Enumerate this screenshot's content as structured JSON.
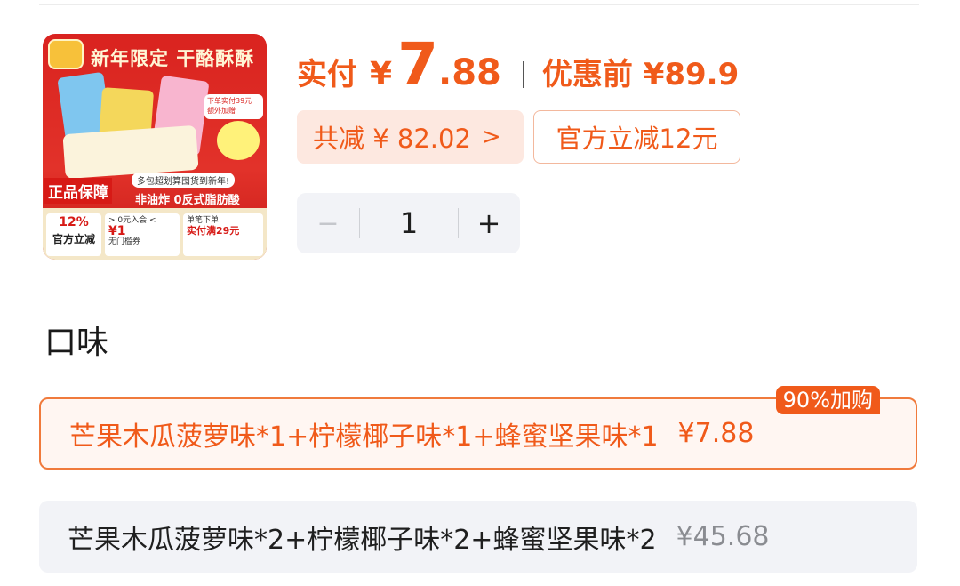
{
  "product": {
    "image": {
      "headline": "新年限定 干酪酥酥",
      "guarantee_badge": "正品保障",
      "slogan": "多包超划算囤货到新年!",
      "feature": "非油炸 0反式脂肪酸",
      "side_note": "下单实付39元 额外加赠",
      "pct_value": "12%",
      "pct_label": "官方立减",
      "coupon_top": "> 0元入会 <",
      "coupon_value": "¥1",
      "coupon_label": "无门槛券",
      "promo_top": "单笔下单",
      "promo_value": "实付满29元"
    }
  },
  "price": {
    "pay_label": "实付",
    "currency": "¥",
    "integer": "7",
    "decimal": ".88",
    "original": "优惠前 ¥89.9",
    "reduce_label": "共减 ¥ 82.02",
    "reduce_chevron": ">",
    "official_discount": "官方立减12元"
  },
  "quantity": {
    "minus": "−",
    "value": "1",
    "plus": "+"
  },
  "flavor": {
    "title": "口味",
    "options": [
      {
        "name": "芒果木瓜菠萝味*1+柠檬椰子味*1+蜂蜜坚果味*1",
        "price": "¥7.88",
        "tag": "90%加购",
        "selected": true
      },
      {
        "name": "芒果木瓜菠萝味*2+柠檬椰子味*2+蜂蜜坚果味*2",
        "price": "¥45.68",
        "selected": false
      }
    ]
  },
  "colors": {
    "accent": "#f05a1a",
    "chip_bg": "#fde8e0",
    "neutral_bg": "#f2f3f7",
    "image_red": "#d9231f"
  }
}
